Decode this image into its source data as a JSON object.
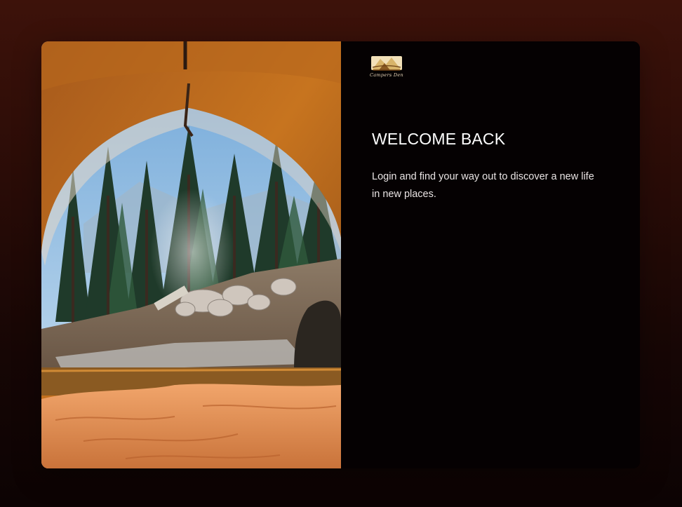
{
  "logo": {
    "text": "Campers Den",
    "icon": "mountain-tent-logo-icon"
  },
  "hero": {
    "image": "tent-view-forest-photo"
  },
  "welcome": {
    "title": "WELCOME BACK",
    "subtitle": "Login and find your way out to discover a new life in new places."
  },
  "colors": {
    "panel": "#050102",
    "background_top": "#3d120a",
    "background_bottom": "#0c0303",
    "logo_gold": "#d8b46a",
    "text": "#ffffff"
  }
}
